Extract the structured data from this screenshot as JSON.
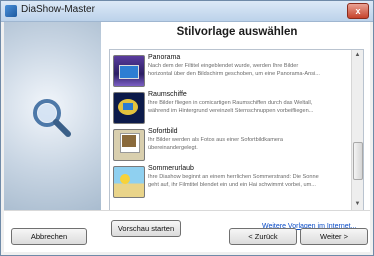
{
  "window": {
    "title": "DiaShow-Master",
    "close_glyph": "x"
  },
  "page": {
    "heading": "Stilvorlage auswählen"
  },
  "templates": [
    {
      "title": "Panorama",
      "desc1": "Nach dem der Filtitel eingeblendet wurde, werden Ihre Bilder",
      "desc2": "horizontal über den Bildschirm geschoben, um eine Panorama-Ansi..."
    },
    {
      "title": "Raumschiffe",
      "desc1": "Ihre Bilder fliegen in comicartigen Raumschiffen durch das Weltall,",
      "desc2": "während im Hintergrund vereinzelt Sternschnuppen vorbeifliegen..."
    },
    {
      "title": "Sofortbild",
      "desc1": "Ihr Bilder werden als Fotos aus einer Sofortbildkamera",
      "desc2": "übereinandergelegt."
    },
    {
      "title": "Sommerurlaub",
      "desc1": "Ihre Diashow beginnt an einem herrlichen Sommerstrand: Die Sonne",
      "desc2": "geht auf, ihr Filmtitel blendet ein und ein Hai schwimmt vorbei, um..."
    }
  ],
  "buttons": {
    "preview": "Vorschau starten",
    "more_templates": "Weitere Vorlagen im Internet...",
    "cancel": "Abbrechen",
    "back": "< Zurück",
    "next": "Weiter >"
  },
  "icons": {
    "app": "app-icon",
    "magnifier": "magnifier-icon"
  },
  "colors": {
    "accent": "#0b4dc7",
    "title_gradient_top": "#dce9f7"
  }
}
